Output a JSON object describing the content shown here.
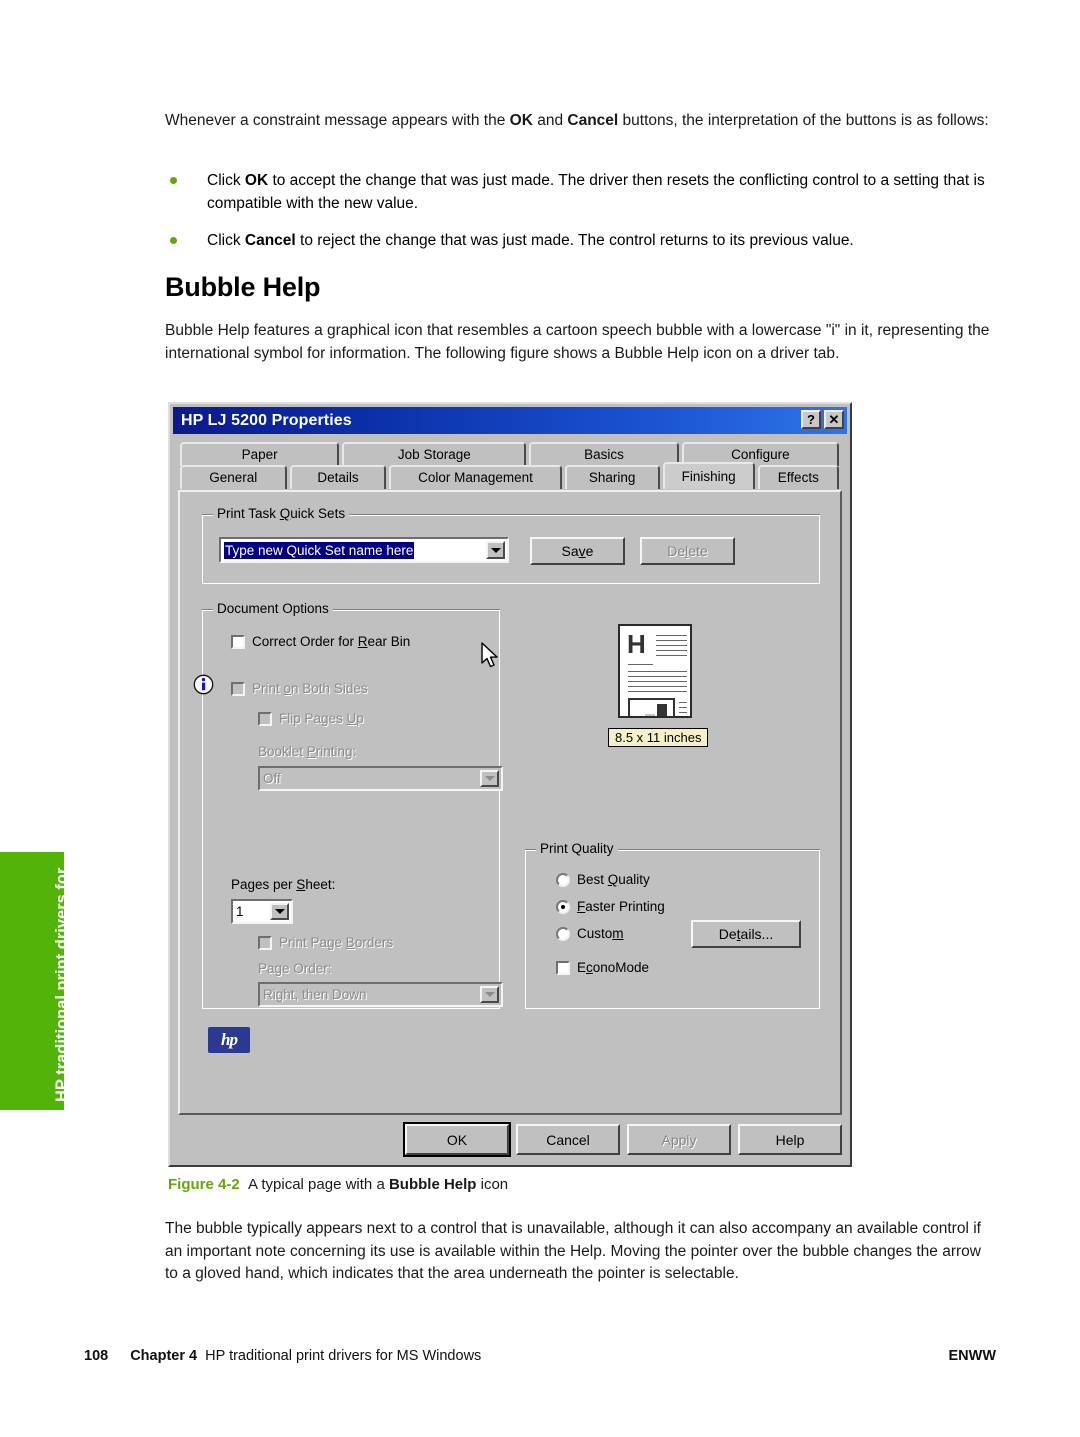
{
  "document": {
    "intro_paragraph_pre": "Whenever a constraint message appears with the ",
    "intro_bold_1": "OK",
    "intro_mid": " and ",
    "intro_bold_2": "Cancel",
    "intro_paragraph_post": " buttons, the interpretation of the buttons is as follows:",
    "bullets": [
      {
        "pre": "Click ",
        "bold": "OK",
        "post": " to accept the change that was just made. The driver then resets the conflicting control to a setting that is compatible with the new value."
      },
      {
        "pre": "Click ",
        "bold": "Cancel",
        "post": " to reject the change that was just made. The control returns to its previous value."
      }
    ],
    "section_heading": "Bubble Help",
    "section_paragraph": "Bubble Help features a graphical icon that resembles a cartoon speech bubble with a lowercase \"i\" in it, representing the international symbol for information. The following figure shows a Bubble Help icon on a driver tab.",
    "closing_paragraph": "The bubble typically appears next to a control that is unavailable, although it can also accompany an available control if an important note concerning its use is available within the Help. Moving the pointer over the bubble changes the arrow to a gloved hand, which indicates that the area underneath the pointer is selectable.",
    "caption": {
      "figure_number": "Figure 4-2",
      "pre": "A typical page with a ",
      "bold": "Bubble Help",
      "post": " icon"
    },
    "side_tab_label": "HP traditional print drivers for MS Windows",
    "footer": {
      "page_number": "108",
      "chapter": "Chapter 4",
      "chapter_title": "HP traditional print drivers for MS Windows",
      "brand": "ENWW"
    },
    "colors": {
      "accent_green": "#52b408",
      "caption_green": "#63a70a",
      "titlebar_blue": "#0a1a8c",
      "selection_blue": "#000080",
      "dialog_face": "#c0c0c0",
      "hp_logo_blue": "#2b3990",
      "badge_yellow": "#f5f0c8"
    }
  },
  "dialog": {
    "title": "HP LJ 5200 Properties",
    "titlebar_buttons": [
      {
        "name": "help-button",
        "glyph": "?"
      },
      {
        "name": "close-button",
        "glyph": "✕"
      }
    ],
    "tabs_row1": [
      {
        "label": "Paper",
        "active": false
      },
      {
        "label": "Job Storage",
        "active": false
      },
      {
        "label": "Basics",
        "active": false
      },
      {
        "label": "Configure",
        "active": false
      }
    ],
    "tabs_row2": [
      {
        "label": "General",
        "active": false
      },
      {
        "label": "Details",
        "active": false
      },
      {
        "label": "Color Management",
        "active": false
      },
      {
        "label": "Sharing",
        "active": false
      },
      {
        "label": "Finishing",
        "active": true
      },
      {
        "label": "Effects",
        "active": false
      }
    ],
    "quick_sets": {
      "group_label_a": "Print Task ",
      "group_label_u": "Q",
      "group_label_b": "uick Sets",
      "combo_value": "Type new Quick Set name here",
      "save_button": "Save",
      "save_u": "v",
      "delete_button": "Delete",
      "delete_enabled": false
    },
    "document_options": {
      "group_label": "Document Options",
      "correct_order": "Correct Order for Rear Bin",
      "correct_order_checked": false,
      "print_both_sides": "Print on Both Sides",
      "print_both_sides_enabled": false,
      "flip_pages_up": "Flip Pages Up",
      "flip_pages_up_enabled": false,
      "booklet_label": "Booklet Printing:",
      "booklet_value": "Off",
      "booklet_enabled": false,
      "pages_per_sheet_label": "Pages per Sheet:",
      "pages_per_sheet_value": "1",
      "print_page_borders": "Print Page Borders",
      "print_page_borders_enabled": false,
      "page_order_label": "Page Order:",
      "page_order_value": "Right, then Down",
      "page_order_enabled": false
    },
    "preview": {
      "letter_glyph": "H",
      "size_badge": "8.5 x 11 inches"
    },
    "print_quality": {
      "group_label": "Print Quality",
      "options": [
        {
          "label": "Best Quality",
          "selected": false
        },
        {
          "label": "Faster Printing",
          "selected": true
        },
        {
          "label": "Custom",
          "selected": false
        }
      ],
      "details_button": "Details...",
      "econo_mode": "EconoMode",
      "econo_mode_checked": false
    },
    "brand_logo": "hp",
    "footer_buttons": [
      {
        "label": "OK",
        "enabled": true,
        "default": true
      },
      {
        "label": "Cancel",
        "enabled": true,
        "default": false
      },
      {
        "label": "Apply",
        "enabled": false,
        "default": false
      },
      {
        "label": "Help",
        "enabled": true,
        "default": false
      }
    ]
  }
}
